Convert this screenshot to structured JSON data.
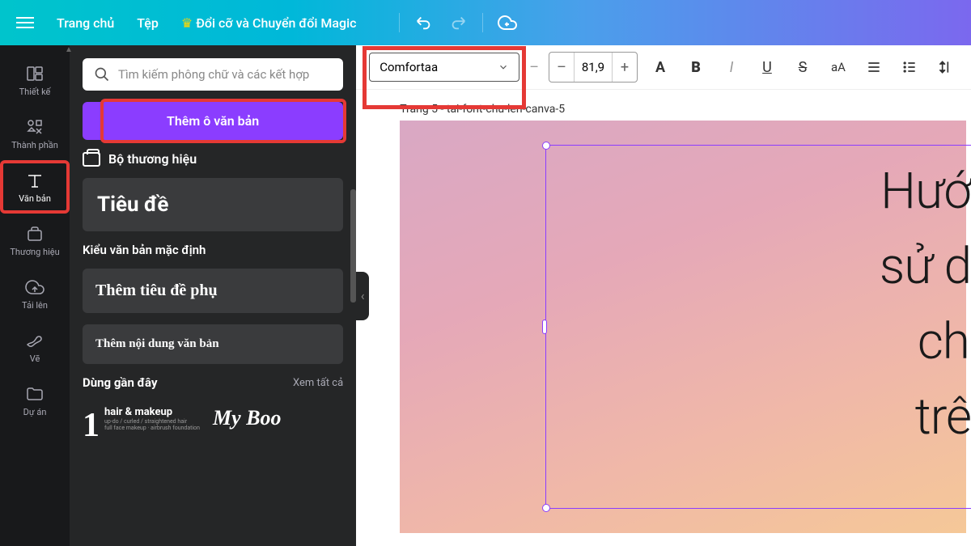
{
  "topbar": {
    "home": "Trang chủ",
    "file": "Tệp",
    "magic": "Đổi cỡ và Chuyển đổi Magic"
  },
  "sidebar": {
    "items": [
      {
        "label": "Thiết kế"
      },
      {
        "label": "Thành phần"
      },
      {
        "label": "Văn bản"
      },
      {
        "label": "Thương hiệu"
      },
      {
        "label": "Tải lên"
      },
      {
        "label": "Vẽ"
      },
      {
        "label": "Dự án"
      }
    ]
  },
  "panel": {
    "search_placeholder": "Tìm kiếm phông chữ và các kết hợp",
    "add_text": "Thêm ô văn bản",
    "brand_kit": "Bộ thương hiệu",
    "heading": "Tiêu đề",
    "default_styles": "Kiểu văn bản mặc định",
    "subheading": "Thêm tiêu đề phụ",
    "body": "Thêm nội dung văn bản",
    "recent": "Dùng gần đây",
    "see_all": "Xem tất cả",
    "sample1_num": "1",
    "sample1_main": "hair & makeup",
    "sample1_sub1": "up-do / curled / straightened hair",
    "sample1_sub2": "full face makeup · airbrush foundation",
    "sample2": "My Boo"
  },
  "toolbar": {
    "font": "Comfortaa",
    "size": "81,9",
    "minus": "–",
    "plus": "+",
    "color_letter": "A",
    "bold": "B",
    "italic": "I",
    "underline": "U",
    "strike": "S",
    "case": "aA"
  },
  "canvas": {
    "page_label": "Trang 5 - tai-font-chu-len-canva-5",
    "text_lines": [
      "Hướn",
      "sử dụ",
      "chữ",
      "trên "
    ]
  }
}
